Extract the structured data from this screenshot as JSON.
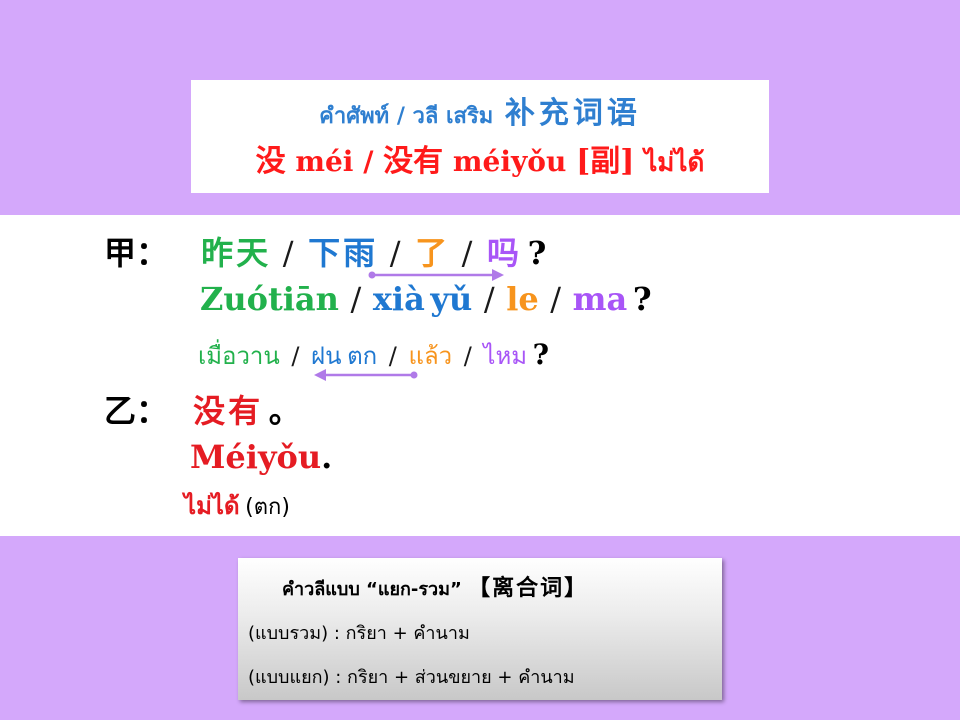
{
  "title_box": {
    "line1_thai": "คำศัพท์ / วลี เสริม",
    "line1_chinese": "补充词语",
    "line2_word1": "没",
    "line2_pinyin1": "méi",
    "line2_slash": "/",
    "line2_word2": "没有",
    "line2_pinyin2": "méiyǒu",
    "line2_pos": "[副]",
    "line2_thai": "ไม่ได้"
  },
  "dialogue": {
    "a_speaker": "甲：",
    "a_hanzi": [
      "昨天",
      "下雨",
      "了",
      "吗"
    ],
    "a_hanzi_end": "?",
    "a_pinyin": [
      "Zuótiān",
      "xià",
      "yǔ",
      "le",
      "ma"
    ],
    "a_pinyin_end": "?",
    "a_thai": [
      "เมื่อวาน",
      "ฝน",
      "ตก",
      "แล้ว",
      "ไหม"
    ],
    "a_thai_end": "?",
    "sep": "/",
    "b_speaker": "乙：",
    "b_hanzi": "没有",
    "b_hanzi_end": "。",
    "b_pinyin": "Méiyǒu",
    "b_pinyin_end": ".",
    "b_thai": "ไม่ได้",
    "b_thai_note": "(ตก)"
  },
  "info_box": {
    "title_thai": "คำวลีแบบ “แยก-รวม”",
    "title_chinese": "【离合词】",
    "line1": "(แบบรวม) : กริยา + คำนาม",
    "line2": "(แบบแยก) : กริยา + ส่วนขยาย + คำนาม"
  },
  "colors": {
    "background_lilac": "#d4a8fb",
    "title_blue": "#2f7fd0",
    "title_red": "#ff1a1a",
    "green": "#22b14c",
    "blue": "#1f78d1",
    "orange": "#f7941d",
    "purple": "#a855f7",
    "red": "#e51c23"
  }
}
